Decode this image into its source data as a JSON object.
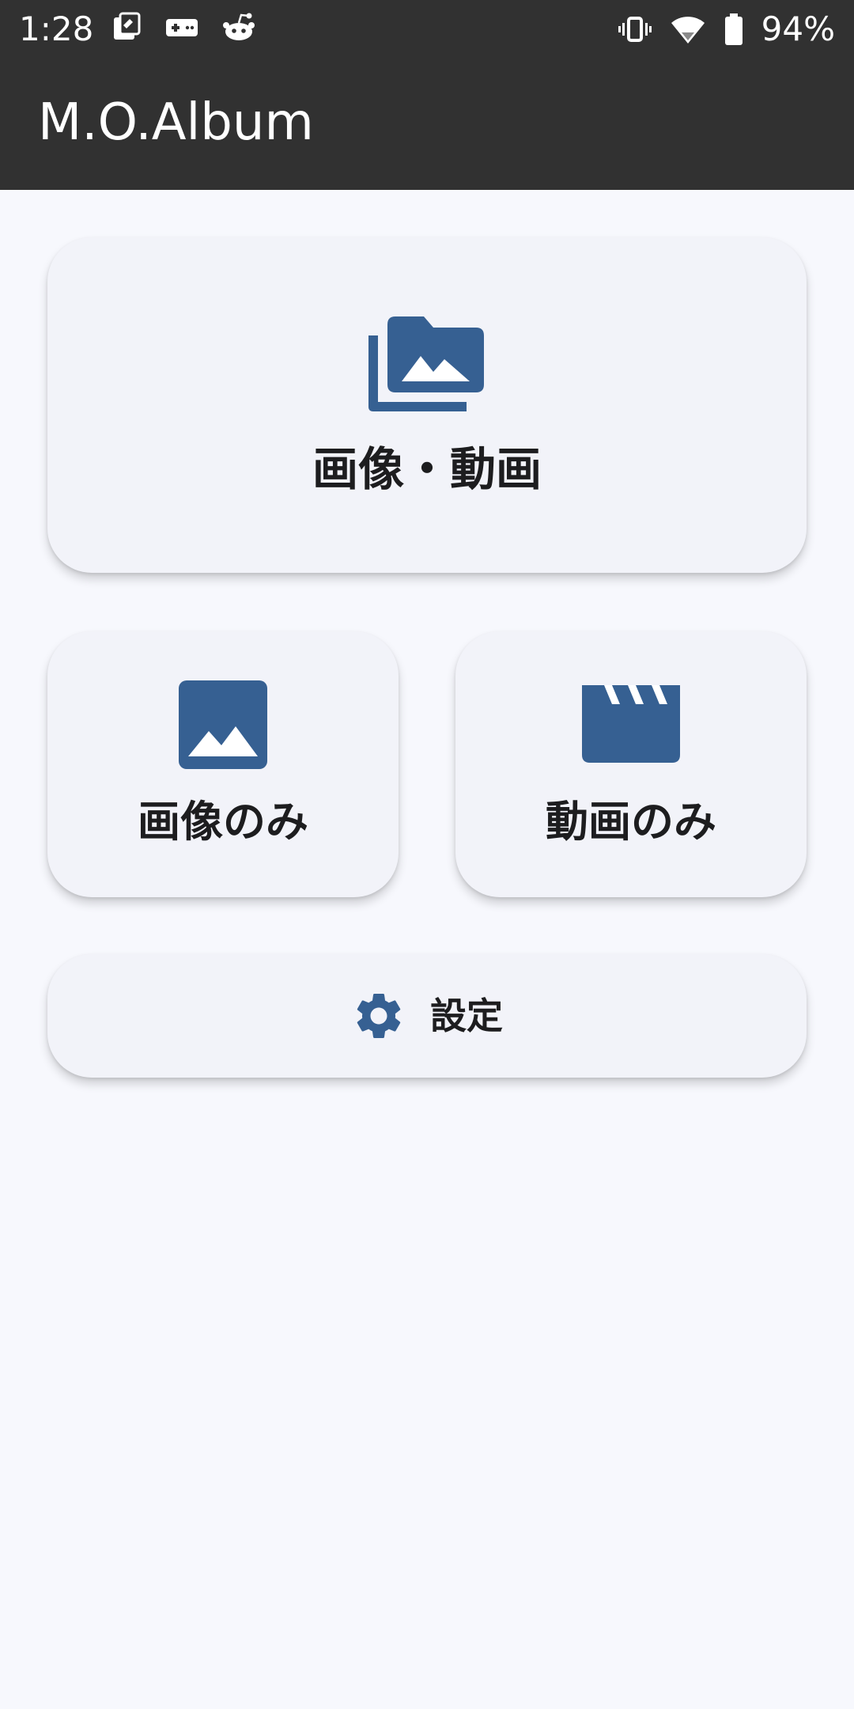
{
  "status_bar": {
    "time": "1:28",
    "battery": "94%",
    "left_icons": [
      "notification-card-icon",
      "game-controller-icon",
      "reddit-icon"
    ],
    "right_icons": [
      "vibrate-icon",
      "wifi-icon",
      "battery-icon"
    ]
  },
  "app_bar": {
    "title": "M.O.Album"
  },
  "main": {
    "all_media": {
      "label": "画像・動画",
      "icon": "photo-library-icon"
    },
    "images_only": {
      "label": "画像のみ",
      "icon": "image-icon"
    },
    "videos_only": {
      "label": "動画のみ",
      "icon": "movie-clapper-icon"
    },
    "settings": {
      "label": "設定",
      "icon": "gear-icon"
    }
  },
  "colors": {
    "bar_background": "#313131",
    "page_background": "#f7f8fd",
    "card_background": "#f2f3f9",
    "icon_accent": "#366092",
    "label_text": "#1d1d1f"
  }
}
